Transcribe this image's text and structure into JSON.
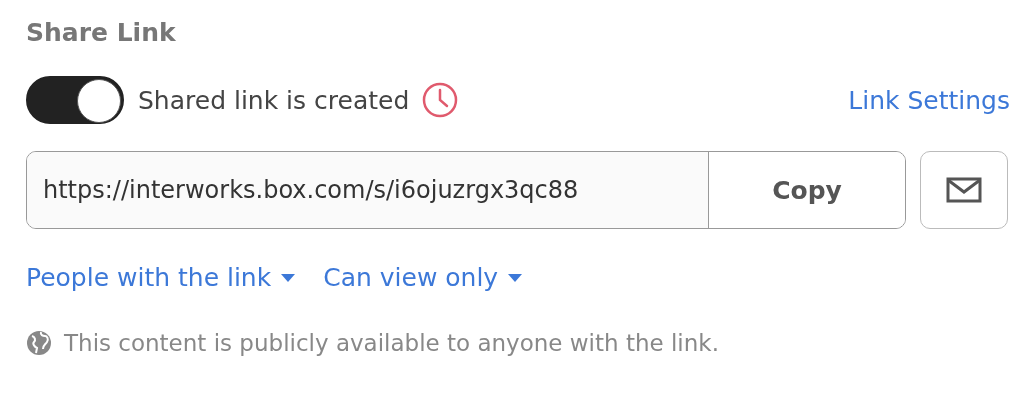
{
  "title": "Share Link",
  "share": {
    "on": true,
    "label": "Shared link is created",
    "settings_link": "Link Settings"
  },
  "link": {
    "value": "https://interworks.box.com/s/i6ojuzrgx3qc88",
    "copy_button": "Copy"
  },
  "dropdowns": [
    {
      "label": "People with the link"
    },
    {
      "label": "Can view only"
    }
  ],
  "notice": "This content is publicly available to anyone with the link."
}
